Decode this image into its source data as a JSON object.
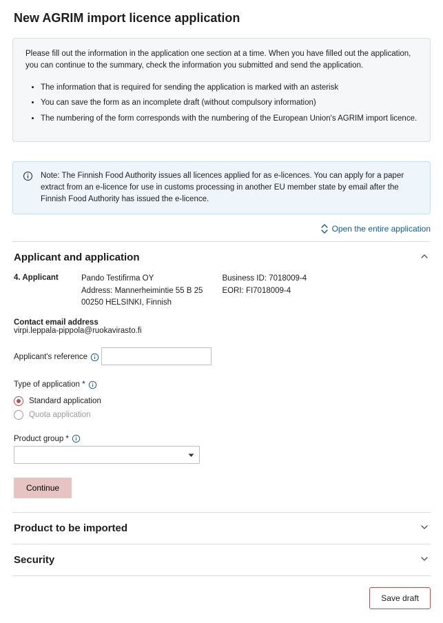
{
  "page_title": "New AGRIM import licence application",
  "instructions": {
    "intro": "Please fill out the information in the application one section at a time. When you have filled out the application, you can continue to the summary, check the information you submitted and send the application.",
    "bullets": [
      "The information that is required for sending the application is marked with an asterisk",
      "You can save the form as an incomplete draft (without compulsory information)",
      "The numbering of the form corresponds with the numbering of the European Union's AGRIM import licence."
    ]
  },
  "note": "Note: The Finnish Food Authority issues all licences applied for as e-licences. You can apply for a paper extract from an e-licence for use in customs processing in another EU member state by email after the Finnish Food Authority has issued the e-licence.",
  "open_all_label": "Open the entire application",
  "sections": {
    "applicant": {
      "title": "Applicant and application",
      "applicant_label": "4. Applicant",
      "company_name": "Pando Testifirma OY",
      "address_line": "Address: Mannerheimintie 55 B 25",
      "city_line": "00250 HELSINKI, Finnish",
      "business_id_line": "Business ID: 7018009-4",
      "eori_line": "EORI: FI7018009-4",
      "contact_label": "Contact email address",
      "contact_email": "virpi.leppala-pippola@ruokavirasto.fi",
      "ref_label": "Applicant's reference",
      "ref_value": "",
      "type_label": "Type of application *",
      "type_options": {
        "standard": "Standard application",
        "quota": "Quota application"
      },
      "product_group_label": "Product group *",
      "product_group_value": "",
      "continue_label": "Continue"
    },
    "product": {
      "title": "Product to be imported"
    },
    "security": {
      "title": "Security"
    }
  },
  "footer": {
    "save_draft_label": "Save draft"
  }
}
